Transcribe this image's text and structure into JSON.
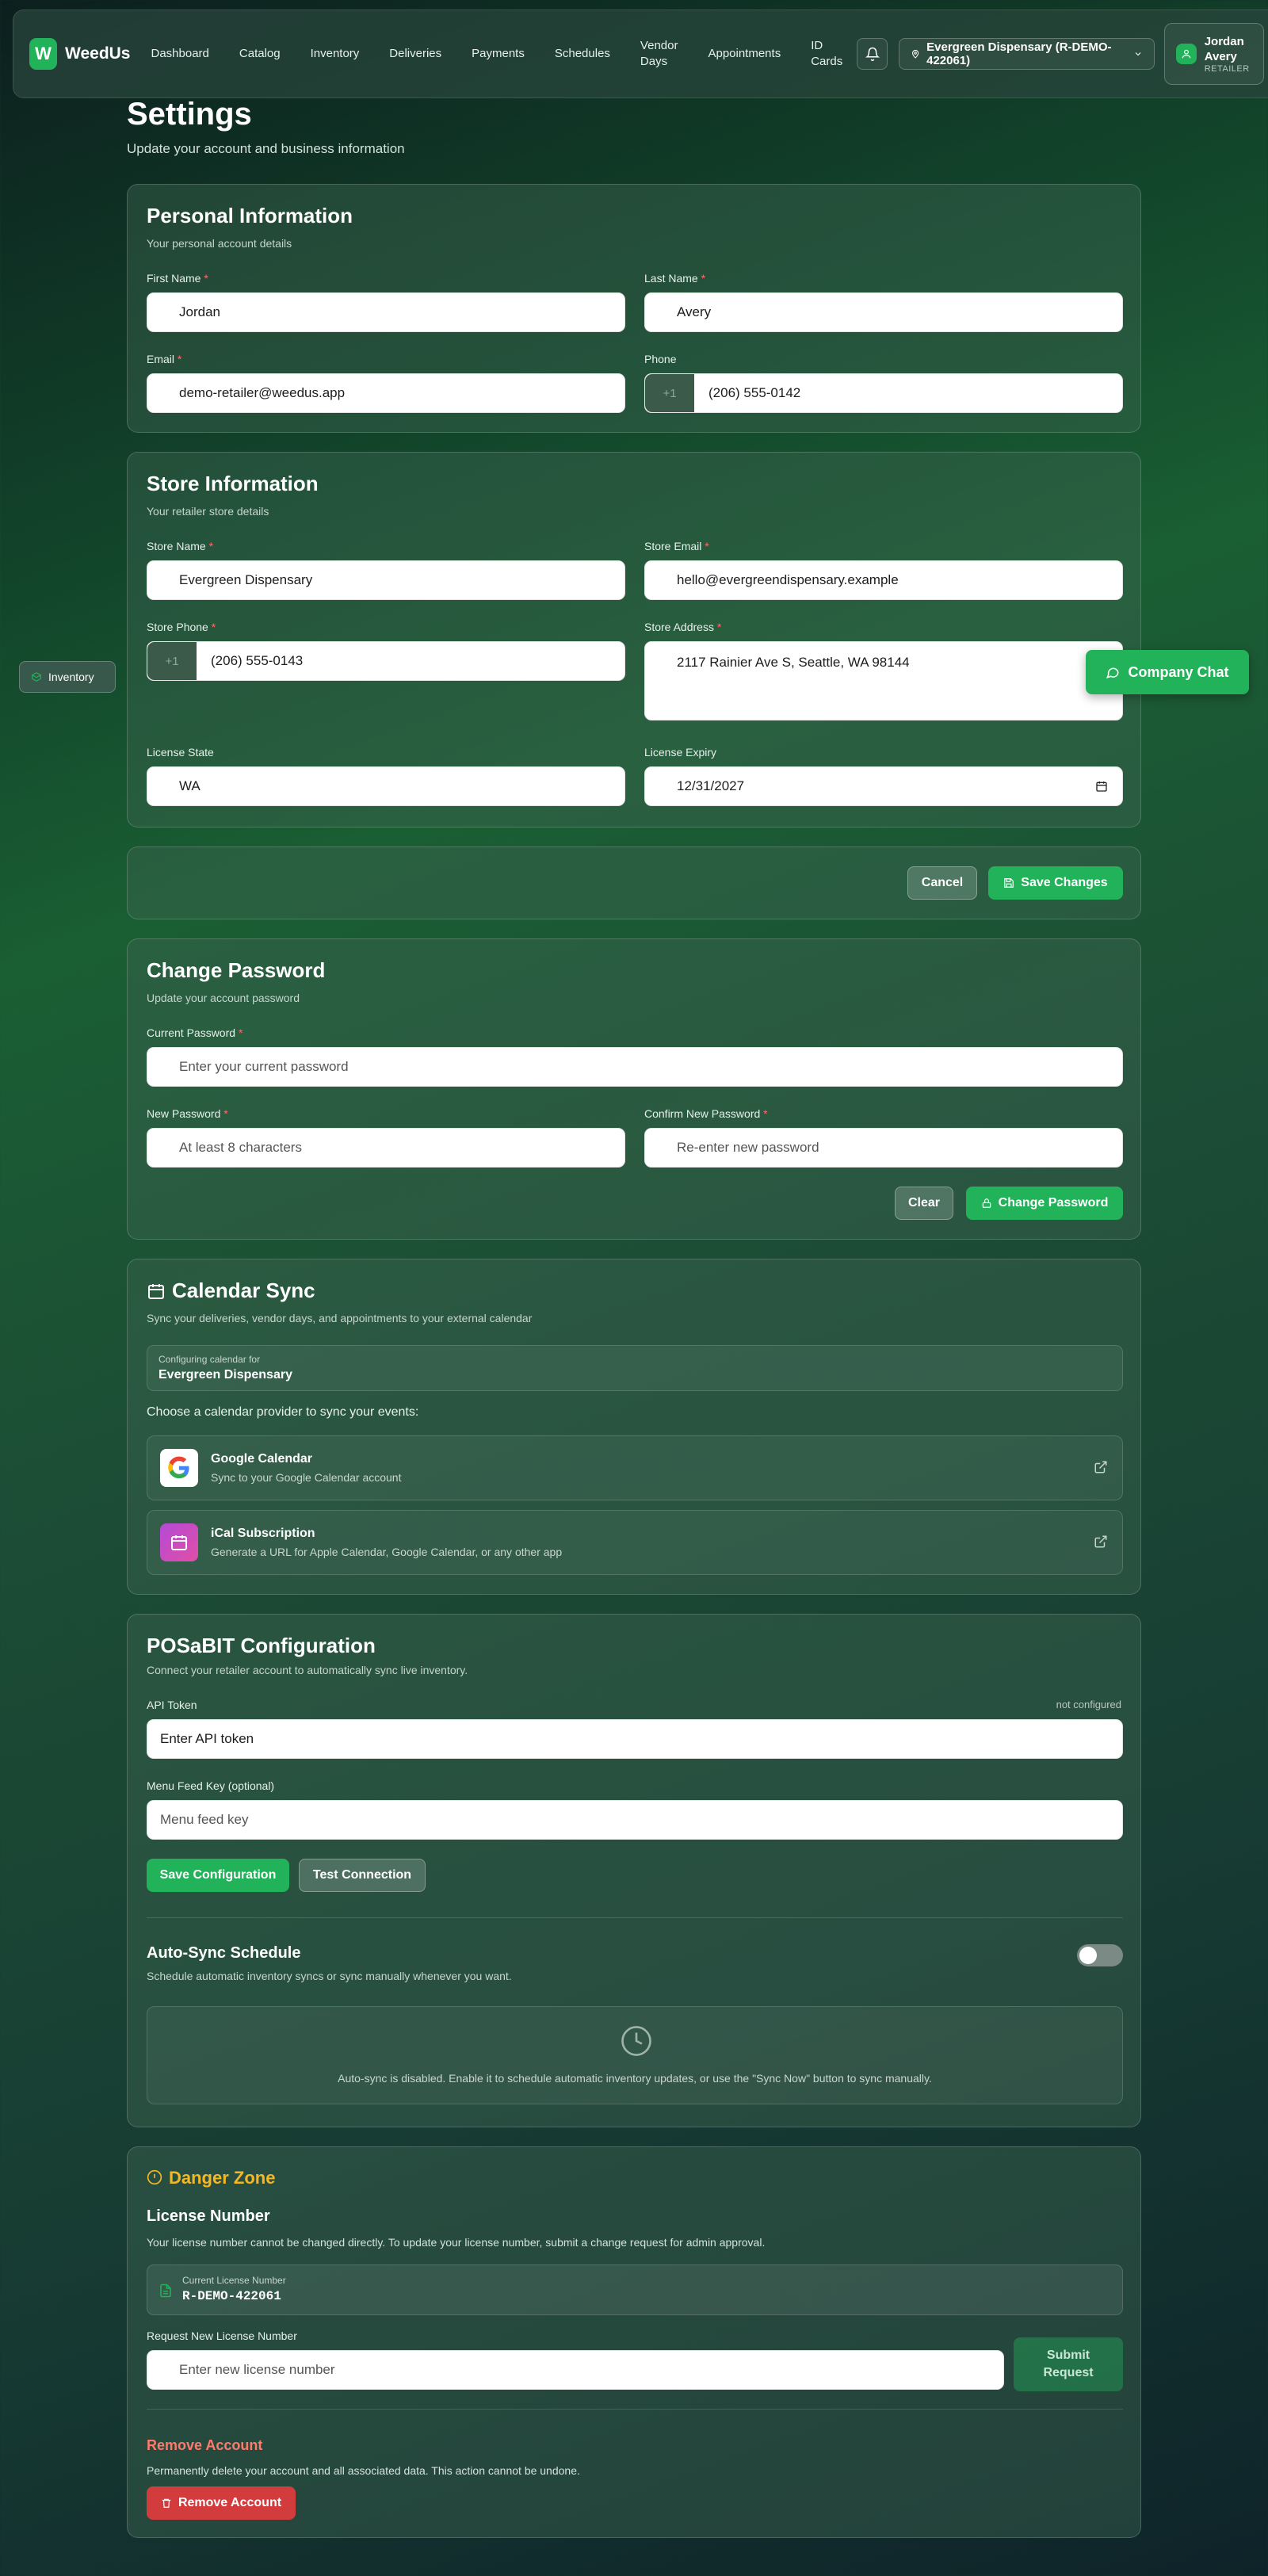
{
  "app": {
    "brand_initial": "W",
    "brand": "WeedUs",
    "nav": [
      "Dashboard",
      "Catalog",
      "Inventory",
      "Deliveries",
      "Payments",
      "Schedules",
      "Vendor Days",
      "Appointments",
      "ID Cards"
    ],
    "store_selector": "Evergreen Dispensary (R-DEMO-422061)",
    "user": {
      "name": "Jordan Avery",
      "role": "RETAILER"
    }
  },
  "page": {
    "title": "Settings",
    "subtitle": "Update your account and business information"
  },
  "personal": {
    "title": "Personal Information",
    "subtitle": "Your personal account details",
    "first_name_label": "First Name",
    "first_name": "Jordan",
    "last_name_label": "Last Name",
    "last_name": "Avery",
    "email_label": "Email",
    "email": "demo-retailer@weedus.app",
    "phone_label": "Phone",
    "phone_prefix": "+1",
    "phone": "(206) 555-0142"
  },
  "store": {
    "title": "Store Information",
    "subtitle": "Your retailer store details",
    "store_name_label": "Store Name",
    "store_name": "Evergreen Dispensary",
    "store_email_label": "Store Email",
    "store_email": "hello@evergreendispensary.example",
    "store_phone_label": "Store Phone",
    "store_phone_prefix": "+1",
    "store_phone": "(206) 555-0143",
    "store_address_label": "Store Address",
    "store_address": "2117 Rainier Ave S, Seattle, WA 98144",
    "license_state_label": "License State",
    "license_state": "WA",
    "license_expiry_label": "License Expiry",
    "license_expiry": "12/31/2027"
  },
  "actions": {
    "cancel": "Cancel",
    "save": "Save Changes"
  },
  "password": {
    "title": "Change Password",
    "subtitle": "Update your account password",
    "current_label": "Current Password",
    "current_placeholder": "Enter your current password",
    "new_label": "New Password",
    "new_placeholder": "At least 8 characters",
    "confirm_label": "Confirm New Password",
    "confirm_placeholder": "Re-enter new password",
    "clear": "Clear",
    "change": "Change Password"
  },
  "calendar": {
    "title": "Calendar Sync",
    "subtitle": "Sync your deliveries, vendor days, and appointments to your external calendar",
    "config_label": "Configuring calendar for",
    "config_value": "Evergreen Dispensary",
    "choose": "Choose a calendar provider to sync your events:",
    "providers": [
      {
        "title": "Google Calendar",
        "subtitle": "Sync to your Google Calendar account"
      },
      {
        "title": "iCal Subscription",
        "subtitle": "Generate a URL for Apple Calendar, Google Calendar, or any other app"
      }
    ]
  },
  "posabit": {
    "title": "POSaBIT Configuration",
    "subtitle": "Connect your retailer account to automatically sync live inventory.",
    "api_label": "API Token",
    "api_status": "not configured",
    "api_placeholder": "Enter API token",
    "menu_label": "Menu Feed Key (optional)",
    "menu_placeholder": "Menu feed key",
    "save": "Save Configuration",
    "test": "Test Connection",
    "autosync_title": "Auto-Sync Schedule",
    "autosync_sub": "Schedule automatic inventory syncs or sync manually whenever you want.",
    "autosync_enabled": false,
    "autosync_msg": "Auto-sync is disabled. Enable it to schedule automatic inventory updates, or use the \"Sync Now\" button to sync manually."
  },
  "danger": {
    "title": "Danger Zone",
    "license_title": "License Number",
    "license_desc": "Your license number cannot be changed directly. To update your license number, submit a change request for admin approval.",
    "current_label": "Current License Number",
    "current_value": "R-DEMO-422061",
    "request_label": "Request New License Number",
    "request_placeholder": "Enter new license number",
    "submit": "Submit Request",
    "remove_title": "Remove Account",
    "remove_desc": "Permanently delete your account and all associated data. This action cannot be undone.",
    "remove_button": "Remove Account"
  },
  "floating": {
    "inventory": "Inventory",
    "chat": "Company Chat"
  },
  "colors": {
    "accent": "#22b35a",
    "danger": "#d33c3c",
    "warning": "#f5b825"
  }
}
